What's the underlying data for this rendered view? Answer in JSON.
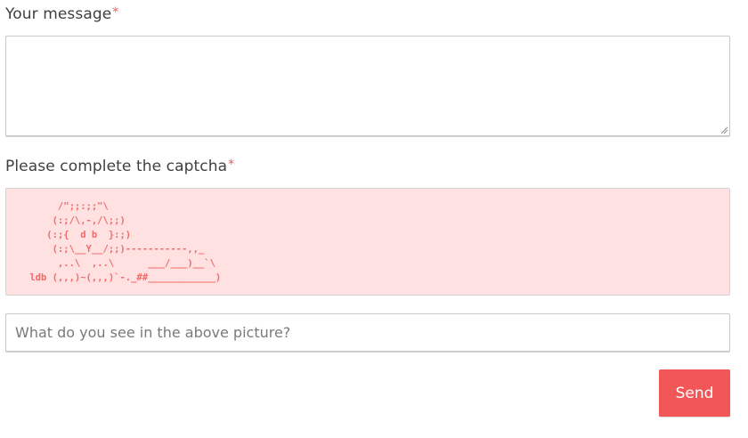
{
  "form": {
    "message_label": "Your message",
    "captcha_label": "Please complete the captcha",
    "required_mark": "*",
    "message_value": "",
    "captcha_art": "      /\";;:;;\"\\\n     (:;/\\,-,/\\;;)\n    (:;{  d b  }:;)\n     (:;\\__Y__/;;)-----------,,_\n      ,..\\  ,..\\      ___/___)__`\\\n ldb (,,,)~(,,,)`-._##____________)",
    "answer_value": "",
    "answer_placeholder": "What do you see in the above picture?",
    "send_label": "Send"
  },
  "colors": {
    "accent": "#f25656",
    "captcha_bg": "#ffe1e1",
    "captcha_text": "#f26a6a",
    "required": "#f15a5a"
  }
}
